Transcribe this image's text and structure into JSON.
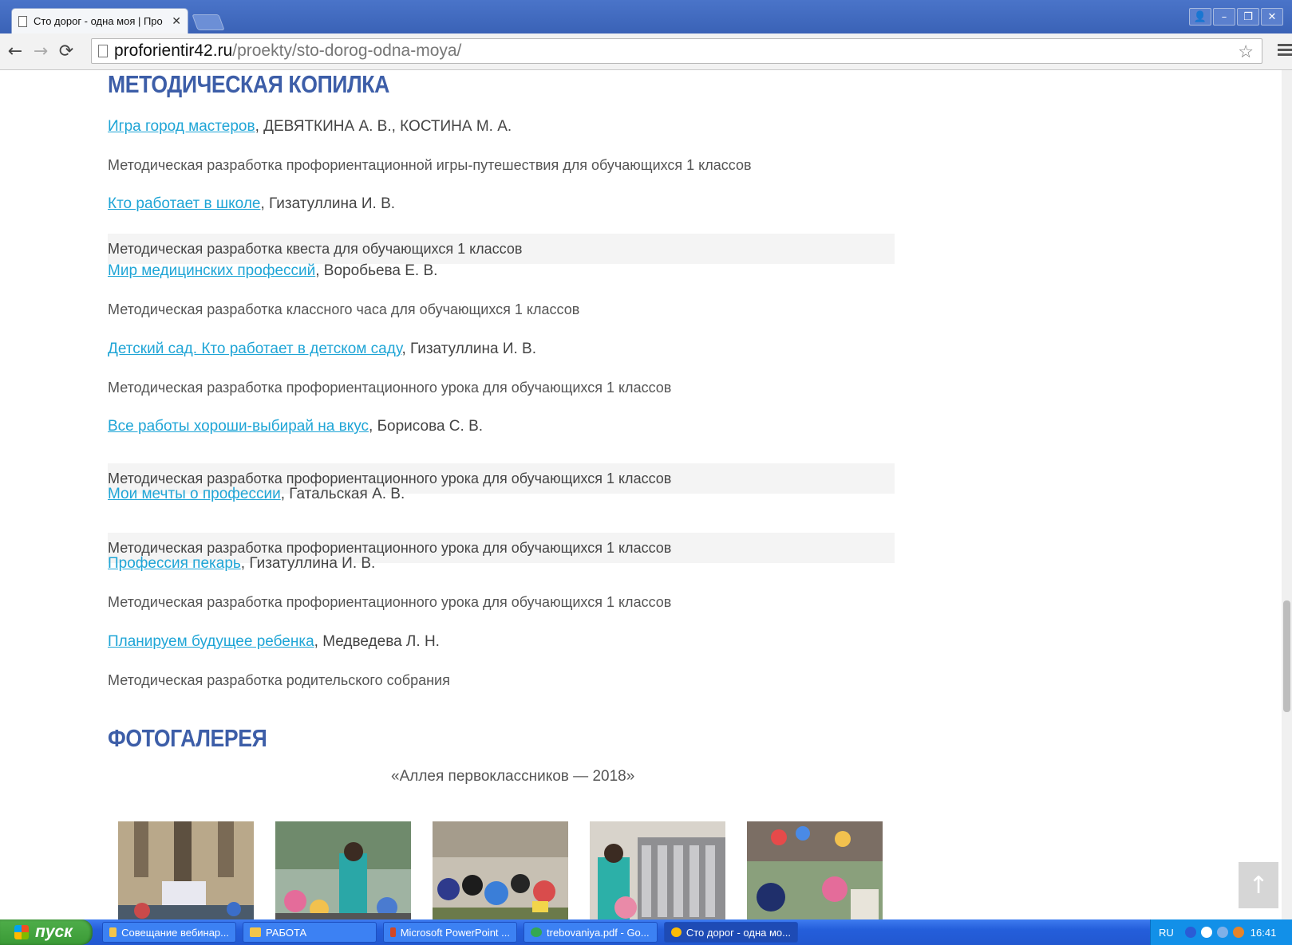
{
  "browser": {
    "tab_title": "Сто дорог - одна моя | Про",
    "tab_close": "✕",
    "url_host": "proforientir42.ru",
    "url_path": "/proekty/sto-dorog-odna-moya/"
  },
  "content": {
    "section1_title": "МЕТОДИЧЕСКАЯ КОПИЛКА",
    "items": [
      {
        "link": "Игра город мастеров",
        "rest": ", ДЕВЯТКИНА  А. В.,  КОСТИНА  М. А.",
        "desc": "Методическая разработка профориентационной игры-путешествия для обучающихся 1 классов"
      },
      {
        "link": "Кто работает в школе",
        "rest": ", Гизатуллина И. В.",
        "desc": "Методическая разработка квеста для обучающихся 1 классов"
      },
      {
        "link": "Мир медицинских профессий",
        "rest": ", Воробьева Е. В.",
        "desc": "Методическая разработка классного часа для обучающихся 1 классов"
      },
      {
        "link": "Детский сад. Кто работает в детском саду",
        "rest": ", Гизатуллина И. В.",
        "desc": "Методическая разработка профориентационного урока для обучающихся 1 классов"
      },
      {
        "link": "Все работы хороши-выбирай на вкус",
        "rest": ", Борисова С. В.",
        "desc": "Методическая разработка профориентационного урока для обучающихся 1 классов"
      },
      {
        "link": "Мои мечты о профессии",
        "rest": ", Гатальская А. В.",
        "desc": "Методическая разработка профориентационного урока для обучающихся 1 классов"
      },
      {
        "link": "Профессия пекарь",
        "rest": ", Гизатуллина И. В.",
        "desc": "Методическая разработка профориентационного урока для обучающихся 1 классов"
      },
      {
        "link": "Планируем будущее ребенка",
        "rest": ", Медведева Л. Н.",
        "desc": "Методическая разработка родительского собрания"
      }
    ],
    "section2_title": "ФОТОГАЛЕРЕЯ",
    "gallery_caption": "«Аллея первоклассников — 2018»",
    "to_top": "↑"
  },
  "taskbar": {
    "start_label": "пуск",
    "tasks": [
      "Совещание вебинар...",
      "РАБОТА",
      "Microsoft PowerPoint ...",
      "trebovaniya.pdf - Go...",
      "Сто дорог - одна мо..."
    ],
    "lang": "RU",
    "clock": "16:41"
  },
  "colors": {
    "heading": "#3d5ea8",
    "link": "#1fa5d6",
    "taskbar": "#245edb",
    "start": "#3a9a36"
  }
}
